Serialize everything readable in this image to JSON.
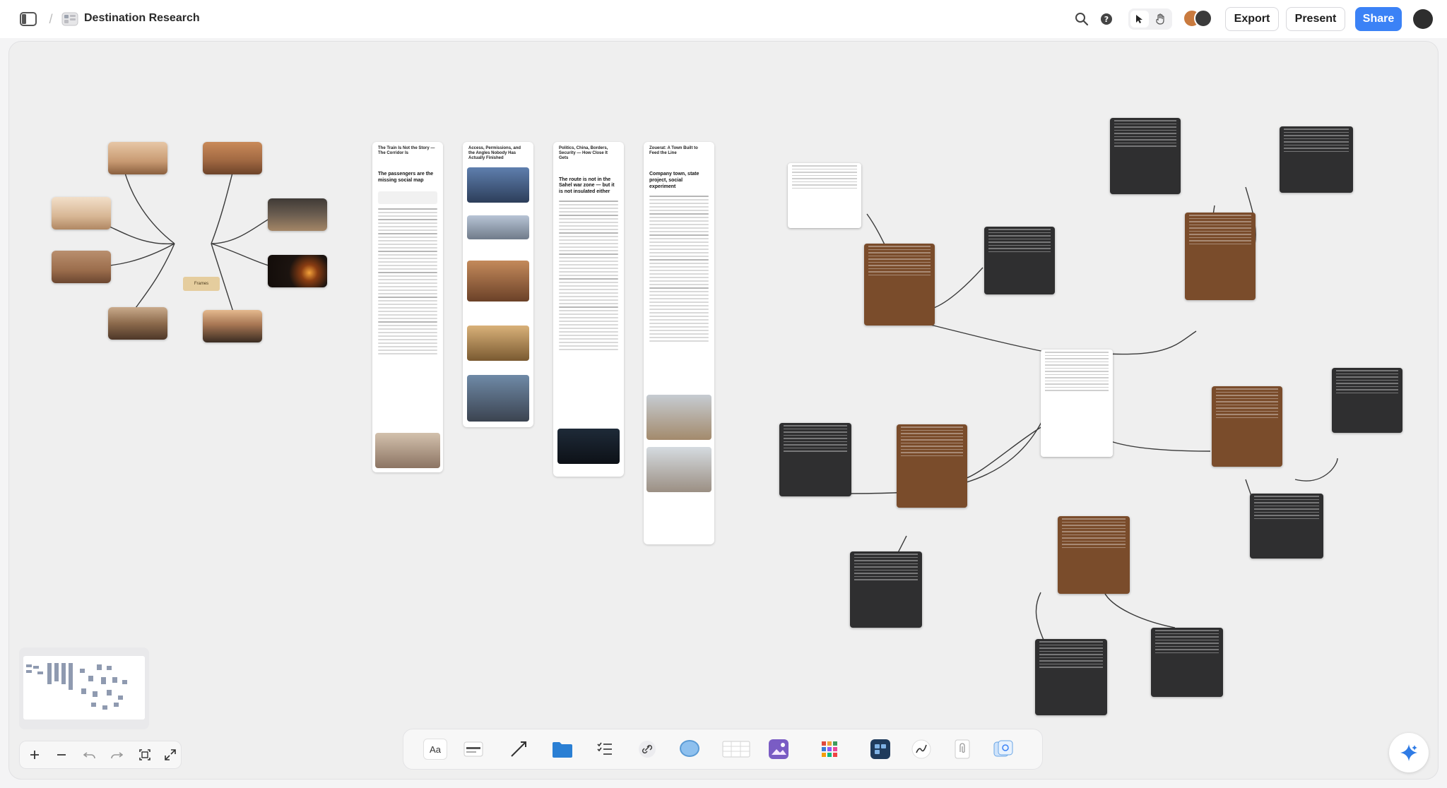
{
  "header": {
    "title": "Destination Research",
    "export_label": "Export",
    "present_label": "Present",
    "share_label": "Share"
  },
  "colors": {
    "accent": "#3b82f6",
    "dark_note": "#2f2f30",
    "brown_note": "#7a4c2b",
    "tag": "#e5cd9e",
    "connector": "#3a3a3a"
  },
  "canvas": {
    "center_tag": "Frames",
    "article_cards": [
      {
        "title": "The Train Is Not the Story — The Corridor Is",
        "headline": "The passengers are the missing social map"
      },
      {
        "title": "Access, Permissions, and the Angles Nobody Has Actually Finished",
        "headline": ""
      },
      {
        "title": "Politics, China, Borders, Security — How Close It Gets",
        "headline": "The route is not in the Sahel war zone — but it is not insulated either"
      },
      {
        "title": "Zouerat: A Town Built to Feed the Line",
        "headline": "Company town, state project, social experiment"
      }
    ]
  },
  "toolbar": {
    "text_tool_label": "Aa",
    "tools": [
      "text-tool",
      "card-tool",
      "line-tool",
      "folder-tool",
      "checklist-tool",
      "link-tool",
      "comment-tool",
      "table-tool",
      "image-tool",
      "apps-tool",
      "app-dark-tool",
      "pen-tool",
      "attach-tool",
      "copy-tool"
    ]
  },
  "zoom": {
    "buttons": [
      "zoom-in",
      "zoom-out",
      "undo",
      "redo",
      "fit",
      "fullscreen"
    ]
  }
}
